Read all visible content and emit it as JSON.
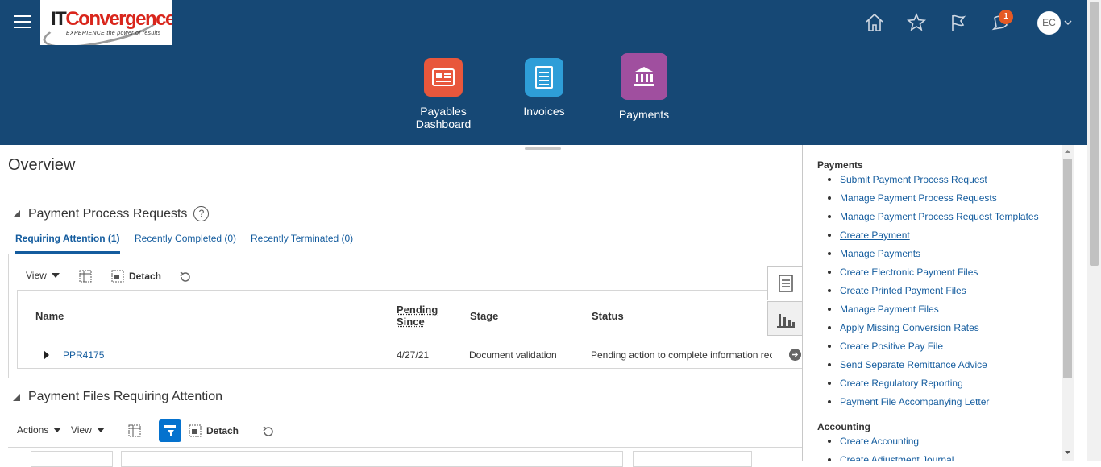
{
  "header": {
    "logo": {
      "brand_it": "IT",
      "brand_rest": "Convergence",
      "tagline": "EXPERIENCE the power of results"
    },
    "icons": [
      "home-icon",
      "star-icon",
      "flag-icon",
      "notifications-icon"
    ],
    "notification_count": "1",
    "avatar_initials": "EC",
    "tiles": [
      {
        "label_line1": "Payables",
        "label_line2": "Dashboard",
        "color": "#e8573c"
      },
      {
        "label_line1": "Invoices",
        "label_line2": "",
        "color": "#2e9ed8"
      },
      {
        "label_line1": "Payments",
        "label_line2": "",
        "color": "#a04f9f"
      }
    ],
    "bg_color": "#164875"
  },
  "page_title": "Overview",
  "ppr": {
    "title": "Payment Process Requests",
    "help": "?",
    "tabs": [
      "Requiring Attention (1)",
      "Recently Completed (0)",
      "Recently Terminated (0)"
    ],
    "toolbar": {
      "view": "View",
      "detach": "Detach"
    },
    "columns": {
      "name": "Name",
      "pending_1": "Pending",
      "pending_2": "Since",
      "stage": "Stage",
      "status": "Status"
    },
    "rows": [
      {
        "name": "PPR4175",
        "pending_since": "4/27/21",
        "stage": "Document validation",
        "status": "Pending action to complete information rec"
      }
    ]
  },
  "payment_files": {
    "title": "Payment Files Requiring Attention",
    "toolbar": {
      "actions": "Actions",
      "view": "View",
      "detach": "Detach"
    }
  },
  "tasks": {
    "payments_heading": "Payments",
    "payments": [
      "Submit Payment Process Request",
      "Manage Payment Process Requests",
      "Manage Payment Process Request Templates",
      "Create Payment",
      "Manage Payments",
      "Create Electronic Payment Files",
      "Create Printed Payment Files",
      "Manage Payment Files",
      "Apply Missing Conversion Rates",
      "Create Positive Pay File",
      "Send Separate Remittance Advice",
      "Create Regulatory Reporting",
      "Payment File Accompanying Letter"
    ],
    "accounting_heading": "Accounting",
    "accounting": [
      "Create Accounting",
      "Create Adjustment Journal"
    ]
  },
  "colors": {
    "link": "#145c9e",
    "accent": "#0572ce"
  }
}
